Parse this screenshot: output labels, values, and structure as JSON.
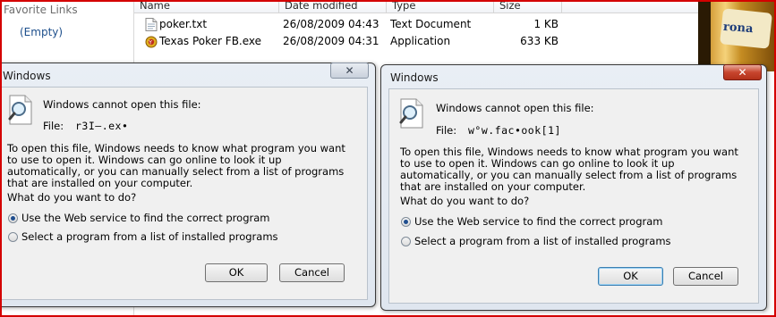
{
  "explorer": {
    "favorites_title": "Favorite Links",
    "favorites_empty": "(Empty)",
    "columns": {
      "name": "Name",
      "date": "Date modified",
      "type": "Type",
      "size": "Size"
    },
    "files": [
      {
        "name": "poker.txt",
        "date": "26/08/2009 04:43",
        "type": "Text Document",
        "size": "1 KB",
        "icon": "text-file-icon"
      },
      {
        "name": "Texas Poker FB.exe",
        "date": "26/08/2009 04:31",
        "type": "Application",
        "size": "633 KB",
        "icon": "poker-app-icon"
      }
    ],
    "bottle_label": "rona"
  },
  "dialog_left": {
    "title": "Windows",
    "heading": "Windows cannot open this file:",
    "file_label": "File:",
    "file_value": "r3I–.ex•",
    "description": "To open this file, Windows needs to know what program you want to use to open it.  Windows can go online to look it up automatically, or you can manually select from a list of programs that are installed on your computer.",
    "question": "What do you want to do?",
    "option_web": "Use the Web service to find the correct program",
    "option_list": "Select a program from a list of installed programs",
    "ok": "OK",
    "cancel": "Cancel",
    "close_glyph": "✕"
  },
  "dialog_right": {
    "title": "Windows",
    "heading": "Windows cannot open this file:",
    "file_label": "File:",
    "file_value": "w°w.fac•ook[1]",
    "description": "To open this file, Windows needs to know what program you want to use to open it.  Windows can go online to look it up automatically, or you can manually select from a list of programs that are installed on your computer.",
    "question": "What do you want to do?",
    "option_web": "Use the Web service to find the correct program",
    "option_list": "Select a program from a list of installed programs",
    "ok": "OK",
    "cancel": "Cancel",
    "close_glyph": "✕"
  },
  "colors": {
    "frame": "#d40000",
    "close_active": "#c7452e",
    "link": "#1d4f8c"
  }
}
